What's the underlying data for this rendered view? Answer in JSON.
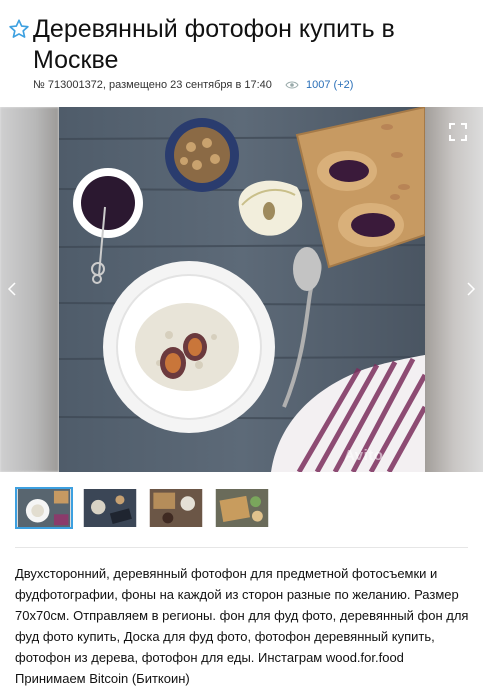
{
  "listing": {
    "title": "Деревянный фотофон купить в Москве",
    "meta_text": "№ 713001372, размещено 23 сентября в 17:40",
    "views": "1007 (+2)"
  },
  "gallery": {
    "watermark": "Avito",
    "thumbnail_count": 4,
    "active_thumbnail": 1
  },
  "description": {
    "text": "Двухсторонний, деревянный фотофон для предметной фотосъемки и фудфотографии, фоны на каждой из сторон разные по желанию. Размер 70х70см. Отправляем в регионы. фон для фуд фото, деревянный фон для фуд фото купить, Доска для фуд фото, фотофон деревянный купить, фотофон из дерева, фотофон для еды. Инстаграм wood.for.food",
    "payment": "Принимаем Bitcoin (Биткоин)"
  },
  "colors": {
    "accent": "#3da0e0",
    "link": "#2a6fb8",
    "star": "#3da0e0"
  },
  "icons": [
    "star-outline-icon",
    "eye-icon",
    "chevron-left-icon",
    "chevron-right-icon",
    "fullscreen-icon"
  ]
}
